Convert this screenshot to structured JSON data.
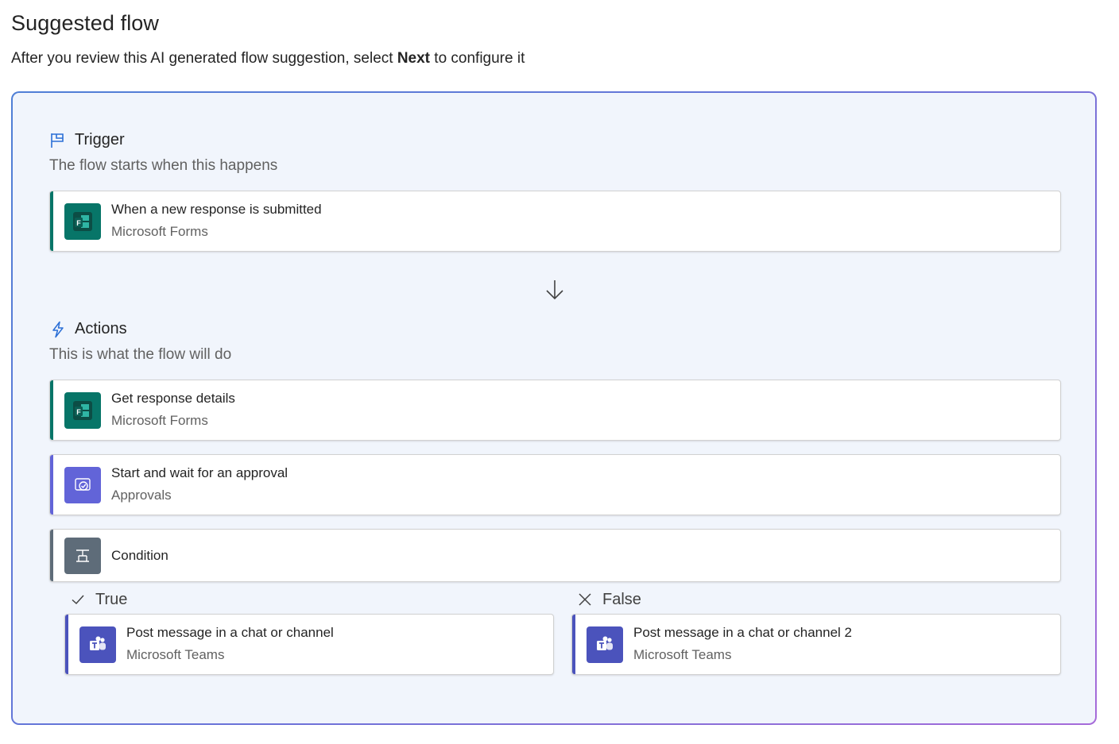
{
  "header": {
    "title": "Suggested flow",
    "subtitle_before": "After you review this AI generated flow suggestion, select ",
    "subtitle_bold": "Next",
    "subtitle_after": " to configure it"
  },
  "trigger": {
    "heading": "Trigger",
    "description": "The flow starts when this happens",
    "icon": "flag-icon",
    "card": {
      "title": "When a new response is submitted",
      "subtitle": "Microsoft Forms",
      "icon": "microsoft-forms-icon",
      "accent": "#077568"
    }
  },
  "actions": {
    "heading": "Actions",
    "description": "This is what the flow will do",
    "icon": "lightning-icon",
    "cards": [
      {
        "title": "Get response details",
        "subtitle": "Microsoft Forms",
        "icon": "microsoft-forms-icon",
        "accent": "#077568"
      },
      {
        "title": "Start and wait for an approval",
        "subtitle": "Approvals",
        "icon": "approvals-icon",
        "accent": "#6264d8"
      },
      {
        "title": "Condition",
        "subtitle": "",
        "icon": "condition-icon",
        "accent": "#5e6c79"
      }
    ]
  },
  "branches": {
    "true": {
      "label": "True",
      "icon": "checkmark-icon",
      "card": {
        "title": "Post message in a chat or channel",
        "subtitle": "Microsoft Teams",
        "icon": "microsoft-teams-icon",
        "accent": "#4b53bc"
      }
    },
    "false": {
      "label": "False",
      "icon": "dismiss-icon",
      "card": {
        "title": "Post message in a chat or channel 2",
        "subtitle": "Microsoft Teams",
        "icon": "microsoft-teams-icon",
        "accent": "#4b53bc"
      }
    }
  },
  "colors": {
    "forms": "#077568",
    "approvals": "#6264d8",
    "condition": "#5e6c79",
    "teams": "#4b53bc",
    "link_blue": "#2b6fd6"
  }
}
